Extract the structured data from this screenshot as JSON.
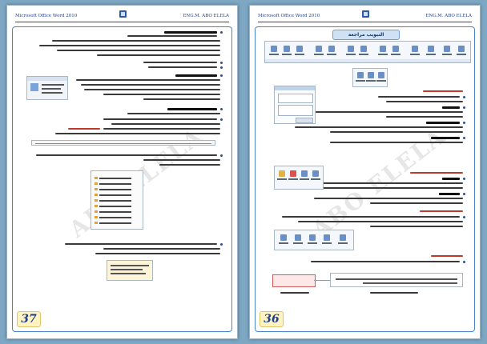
{
  "document": {
    "header_left": "Microsoft Office Word 2010",
    "header_right": "ENG.M. ABO ELELA",
    "watermark": "ABO ELELA"
  },
  "pages": {
    "left": {
      "number": "37"
    },
    "right": {
      "number": "36",
      "section_banner": "التبويب مراجعة"
    }
  },
  "colors": {
    "background": "#7ea7c4",
    "frame": "#4a86c6",
    "header_text": "#1f3f8a",
    "heading_red": "#c0392b"
  }
}
